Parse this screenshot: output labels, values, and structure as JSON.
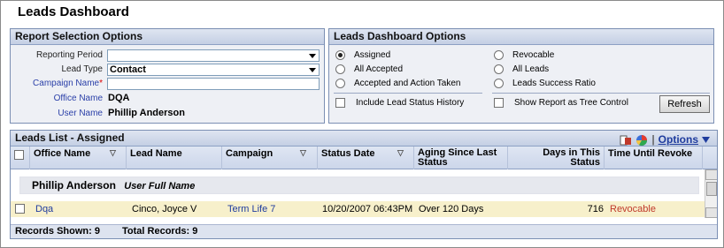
{
  "page_title": "Leads Dashboard",
  "report_selection": {
    "title": "Report Selection Options",
    "reporting_period_label": "Reporting Period",
    "reporting_period_value": "",
    "lead_type_label": "Lead Type",
    "lead_type_value": "Contact",
    "campaign_label": "Campaign Name",
    "campaign_required": "*",
    "campaign_value": "",
    "office_label": "Office Name",
    "office_value": "DQA",
    "user_label": "User Name",
    "user_value": "Phillip Anderson"
  },
  "dashboard_options": {
    "title": "Leads Dashboard Options",
    "radios": [
      {
        "label": "Assigned",
        "checked": true
      },
      {
        "label": "All Accepted",
        "checked": false
      },
      {
        "label": "Accepted and Action Taken",
        "checked": false
      },
      {
        "label": "Revocable",
        "checked": false
      },
      {
        "label": "All Leads",
        "checked": false
      },
      {
        "label": "Leads Success Ratio",
        "checked": false
      }
    ],
    "include_history_label": "Include Lead Status History",
    "tree_control_label": "Show Report as Tree Control",
    "refresh_label": "Refresh"
  },
  "leads_list": {
    "title": "Leads List - Assigned",
    "options_label": "Options",
    "columns": [
      "Office Name",
      "Lead Name",
      "Campaign",
      "Status Date",
      "Aging Since Last Status",
      "Days in This Status",
      "Time Until Revoke"
    ],
    "group": {
      "name": "Phillip Anderson",
      "hint": "User Full Name"
    },
    "rows": [
      {
        "office": "Dqa",
        "lead": "Cinco, Joyce V",
        "campaign": "Term Life 7",
        "status_date": "10/20/2007 06:43PM",
        "aging": "Over 120 Days",
        "days": "716",
        "revoke": "Revocable"
      }
    ],
    "records_shown": "Records Shown: 9",
    "total_records": "Total Records: 9"
  },
  "colors": {
    "accent": "#1f3c9e",
    "revocable": "#c0392b",
    "row_highlight": "#f7f0cb"
  }
}
